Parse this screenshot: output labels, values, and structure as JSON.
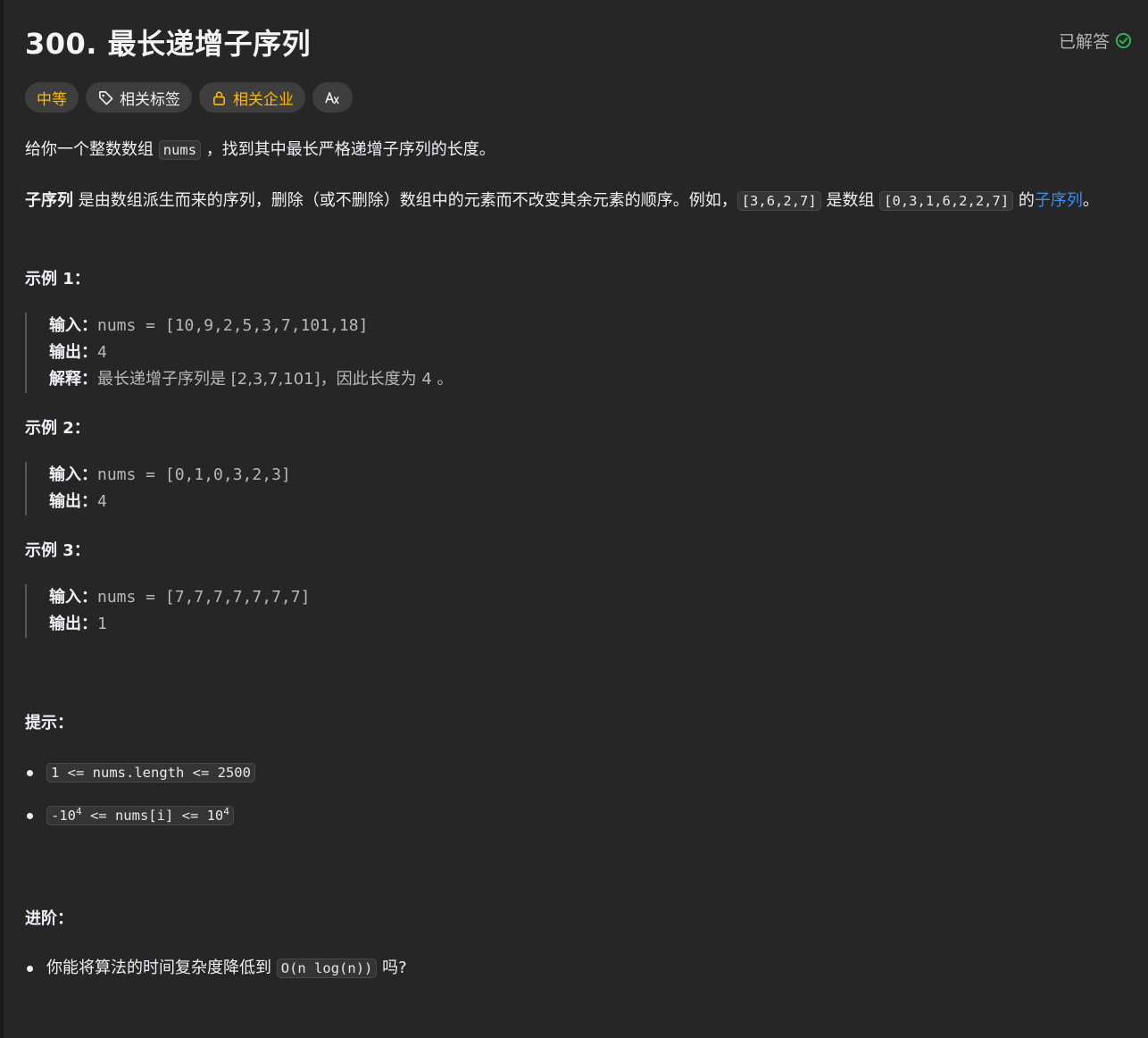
{
  "header": {
    "title": "300. 最长递增子序列",
    "status": "已解答",
    "status_color": "#2cbb5d"
  },
  "tags": {
    "difficulty": "中等",
    "topics": "相关标签",
    "companies": "相关企业",
    "translate_icon": "Aa-translate-icon"
  },
  "description": {
    "p1_pre": "给你一个整数数组 ",
    "p1_code": "nums",
    "p1_post": " ，找到其中最长严格递增子序列的长度。",
    "p2_bold": "子序列",
    "p2_text": " 是由数组派生而来的序列，删除（或不删除）数组中的元素而不改变其余元素的顺序。例如，",
    "p2_code1": "[3,6,2,7]",
    "p2_mid": " 是数组 ",
    "p2_code2": "[0,3,1,6,2,2,7]",
    "p2_de": " 的",
    "p2_link": "子序列",
    "p2_end": "。"
  },
  "examples": [
    {
      "title": "示例 1：",
      "input_label": "输入：",
      "input": "nums = [10,9,2,5,3,7,101,18]",
      "output_label": "输出：",
      "output": "4",
      "expl_label": "解释：",
      "expl": "最长递增子序列是 [2,3,7,101]，因此长度为 4 。"
    },
    {
      "title": "示例 2：",
      "input_label": "输入：",
      "input": "nums = [0,1,0,3,2,3]",
      "output_label": "输出：",
      "output": "4"
    },
    {
      "title": "示例 3：",
      "input_label": "输入：",
      "input": "nums = [7,7,7,7,7,7,7]",
      "output_label": "输出：",
      "output": "1"
    }
  ],
  "constraints": {
    "title": "提示：",
    "c1": "1 <= nums.length <= 2500",
    "c2_pre": "-10",
    "c2_exp1": "4",
    "c2_mid": " <= nums[i] <= 10",
    "c2_exp2": "4"
  },
  "followup": {
    "title": "进阶：",
    "pre": "你能将算法的时间复杂度降低到 ",
    "code": "O(n log(n))",
    "post": " 吗?"
  }
}
